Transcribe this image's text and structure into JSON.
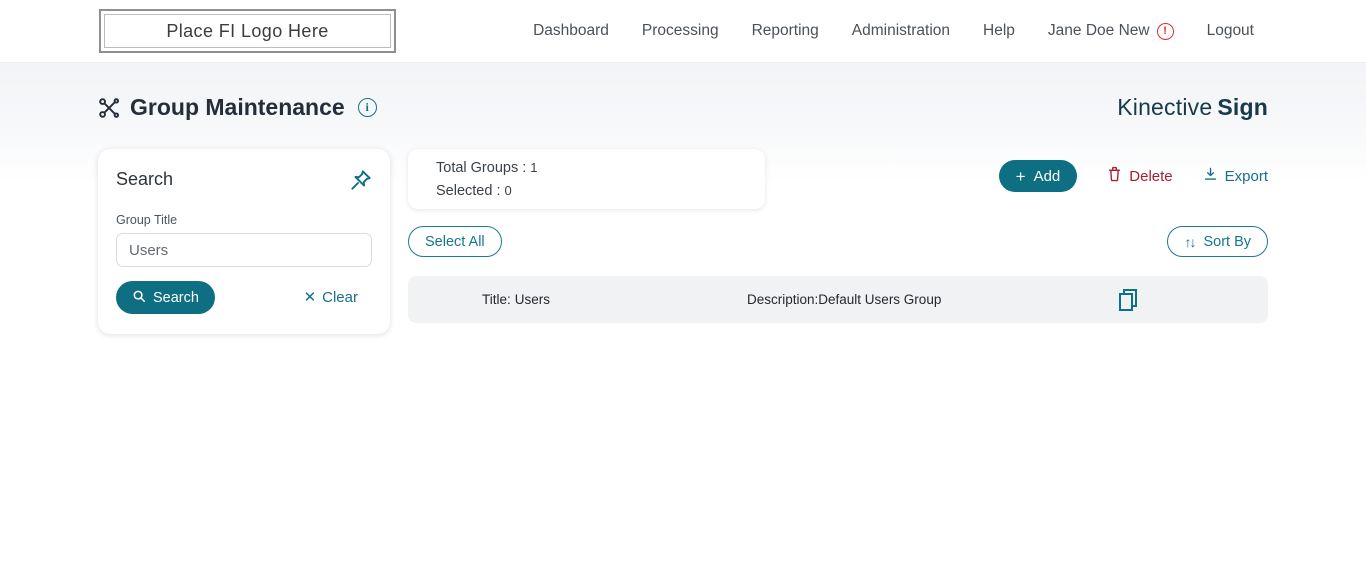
{
  "topnav": {
    "logo_text": "Place FI Logo Here",
    "items": [
      {
        "label": "Dashboard"
      },
      {
        "label": "Processing"
      },
      {
        "label": "Reporting"
      },
      {
        "label": "Administration"
      },
      {
        "label": "Help"
      }
    ],
    "user_label": "Jane Doe New",
    "logout_label": "Logout"
  },
  "header": {
    "title": "Group Maintenance",
    "brand_regular": "Kinective",
    "brand_bold": "Sign"
  },
  "search_panel": {
    "title": "Search",
    "field_label": "Group Title",
    "field_value": "Users",
    "search_button": "Search",
    "clear_button": "Clear"
  },
  "summary": {
    "total_label": "Total Groups :",
    "total_value": "1",
    "selected_label": "Selected :",
    "selected_value": "0"
  },
  "actions": {
    "add_label": "Add",
    "delete_label": "Delete",
    "export_label": "Export",
    "select_all_label": "Select All",
    "sort_by_label": "Sort By"
  },
  "groups": {
    "0": {
      "title_label": "Title:",
      "title_value": "Users",
      "description_label": "Description:",
      "description_value": "Default Users Group"
    }
  },
  "icons": {
    "alert_glyph": "!",
    "info_glyph": "i",
    "plus_glyph": "+",
    "clear_glyph": "✕",
    "sort_glyph": "↑↓"
  },
  "colors": {
    "accent_teal": "#0e6e82",
    "link_teal": "#15718a",
    "danger_red": "#a32033",
    "alert_red": "#e02d2d",
    "title_dark": "#252e38",
    "brand_dark": "#17394a",
    "row_gray": "#f1f2f4"
  }
}
